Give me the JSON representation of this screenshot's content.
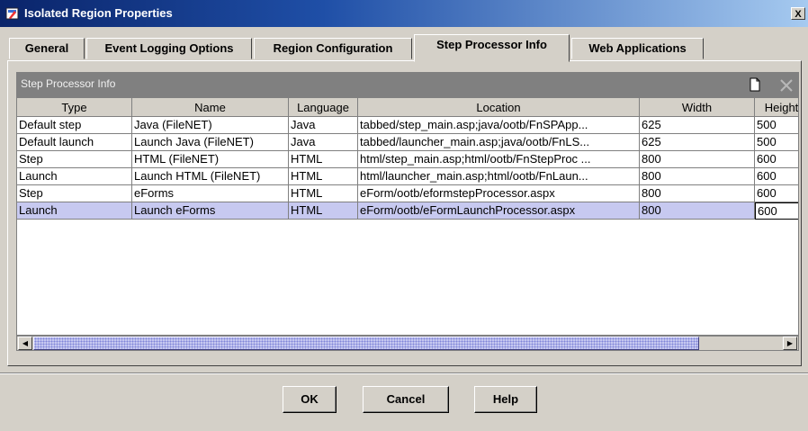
{
  "window": {
    "title": "Isolated Region Properties",
    "close_label": "X"
  },
  "tabs": [
    {
      "label": "General",
      "active": false
    },
    {
      "label": "Event Logging Options",
      "active": false
    },
    {
      "label": "Region Configuration",
      "active": false
    },
    {
      "label": "Step Processor Info",
      "active": true
    },
    {
      "label": "Web Applications",
      "active": false
    }
  ],
  "section": {
    "title": "Step Processor Info",
    "icons": [
      "new-document-icon",
      "delete-x-icon"
    ]
  },
  "table": {
    "columns": [
      "Type",
      "Name",
      "Language",
      "Location",
      "Width",
      "Height"
    ],
    "rows": [
      [
        "Default step",
        "Java (FileNET)",
        "Java",
        "tabbed/step_main.asp;java/ootb/FnSPApp...",
        "625",
        "500"
      ],
      [
        "Default launch",
        "Launch Java (FileNET)",
        "Java",
        "tabbed/launcher_main.asp;java/ootb/FnLS...",
        "625",
        "500"
      ],
      [
        "Step",
        "HTML (FileNET)",
        "HTML",
        "html/step_main.asp;html/ootb/FnStepProc ...",
        "800",
        "600"
      ],
      [
        "Launch",
        "Launch HTML (FileNET)",
        "HTML",
        "html/launcher_main.asp;html/ootb/FnLaun...",
        "800",
        "600"
      ],
      [
        "Step",
        "eForms",
        "HTML",
        "eForm/ootb/eformstepProcessor.aspx",
        "800",
        "600"
      ],
      [
        "Launch",
        "Launch eForms",
        "HTML",
        "eForm/ootb/eFormLaunchProcessor.aspx",
        "800",
        "600"
      ]
    ],
    "selected_row": 5
  },
  "scrollbar": {
    "left_arrow": "◀",
    "right_arrow": "▶"
  },
  "buttons": {
    "ok": "OK",
    "cancel": "Cancel",
    "help": "Help"
  },
  "colors": {
    "title_bar": "#0a246a",
    "selected_row": "#c7c9f0",
    "section_header": "#808080",
    "dialog_bg": "#d4d0c8"
  }
}
